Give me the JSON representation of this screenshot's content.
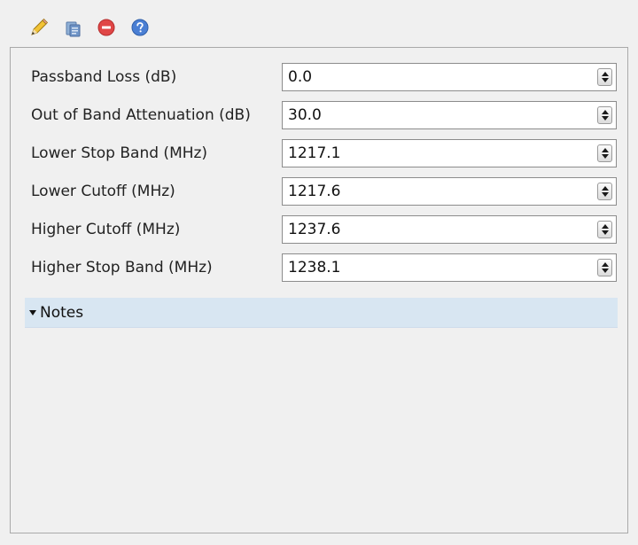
{
  "toolbar": {
    "buttons": [
      {
        "icon": "pencil-icon"
      },
      {
        "icon": "clipboard-icon"
      },
      {
        "icon": "remove-icon"
      },
      {
        "icon": "help-icon"
      }
    ]
  },
  "fields": [
    {
      "label": "Passband Loss (dB)",
      "value": "0.0"
    },
    {
      "label": "Out of Band Attenuation (dB)",
      "value": "30.0"
    },
    {
      "label": "Lower Stop Band (MHz)",
      "value": "1217.1"
    },
    {
      "label": "Lower Cutoff (MHz)",
      "value": "1217.6"
    },
    {
      "label": "Higher Cutoff (MHz)",
      "value": "1237.6"
    },
    {
      "label": "Higher Stop Band (MHz)",
      "value": "1238.1"
    }
  ],
  "notes": {
    "label": "Notes",
    "expanded": true
  },
  "colors": {
    "window_bg": "#f0f0f0",
    "notes_header_bg": "#d8e6f2",
    "remove_icon": "#e04646",
    "help_icon": "#4a7fd4"
  }
}
